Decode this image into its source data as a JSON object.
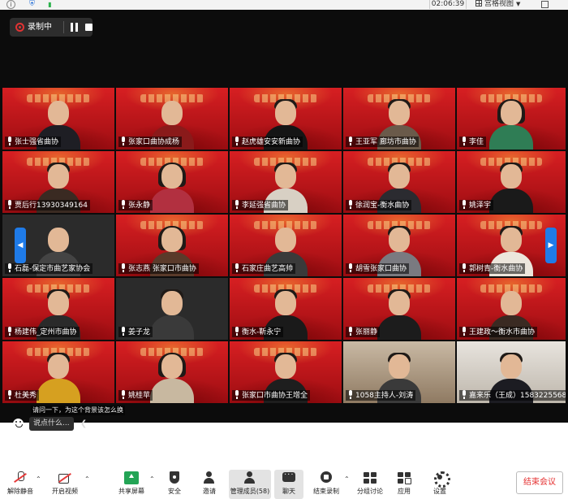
{
  "status_bar": {
    "clock": "02:06:39",
    "view_mode": "宫格视图"
  },
  "recording": {
    "label": "录制中"
  },
  "participants": [
    {
      "name": "张士强省曲协",
      "bg": "red",
      "style": "bald",
      "shirt": "#1e1e24"
    },
    {
      "name": "张家口曲协成杨",
      "bg": "red",
      "style": "bald",
      "shirt": "#8a1a1a"
    },
    {
      "name": "赵虎雄安安新曲协",
      "bg": "red",
      "style": "short",
      "shirt": "#151515"
    },
    {
      "name": "王亚军  廊坊市曲协",
      "bg": "red",
      "style": "short",
      "shirt": "#6a5a4a"
    },
    {
      "name": "李佳",
      "bg": "red",
      "style": "long",
      "shirt": "#2f7d55"
    },
    {
      "name": "贾后行13930349164",
      "bg": "red",
      "style": "short",
      "shirt": "#3a2a22"
    },
    {
      "name": "张永静",
      "bg": "red",
      "style": "long",
      "shirt": "#b23040"
    },
    {
      "name": "李延强省曲协",
      "bg": "red",
      "style": "short",
      "shirt": "#d8d0c4"
    },
    {
      "name": "徐润宝-衡水曲协",
      "bg": "red",
      "style": "short",
      "shirt": "#2b2b30"
    },
    {
      "name": "姚泽宇",
      "bg": "red",
      "style": "short",
      "shirt": "#1a1a1a"
    },
    {
      "name": "石磊-保定市曲艺家协会",
      "bg": "dark",
      "style": "bald",
      "shirt": "#444444"
    },
    {
      "name": "张志燕 张家口市曲协",
      "bg": "red",
      "style": "long",
      "shirt": "#5a3a2a"
    },
    {
      "name": "石家庄曲艺高帅",
      "bg": "red",
      "style": "bald",
      "shirt": "#3a3a3a"
    },
    {
      "name": "胡雪张家口曲协",
      "bg": "red",
      "style": "short",
      "shirt": "#7a7a80"
    },
    {
      "name": "郭树青-衡水曲协",
      "bg": "red",
      "style": "short",
      "shirt": "#ece6dc"
    },
    {
      "name": "杨建伟_定州市曲协",
      "bg": "red",
      "style": "short",
      "shirt": "#2a2a2a"
    },
    {
      "name": "姜子龙",
      "bg": "dark",
      "style": "short",
      "shirt": "#3a3a3a"
    },
    {
      "name": "衡水-靳永宁",
      "bg": "red",
      "style": "short",
      "shirt": "#1a1a1a"
    },
    {
      "name": "张丽静",
      "bg": "red",
      "style": "short",
      "shirt": "#1c1c1c"
    },
    {
      "name": "王建政～衡水市曲协",
      "bg": "red",
      "style": "bald",
      "shirt": "#3a2a22"
    },
    {
      "name": "杜美秀",
      "bg": "red",
      "style": "short",
      "shirt": "#d6a020"
    },
    {
      "name": "姚桂苹",
      "bg": "red",
      "style": "long",
      "shirt": "#c8b8a0"
    },
    {
      "name": "张家口市曲协王增全",
      "bg": "red",
      "style": "short",
      "shirt": "#1e1e1e"
    },
    {
      "name": "1058主持人-刘涛",
      "bg": "room",
      "style": "short",
      "shirt": "#3a3a3a"
    },
    {
      "name": "嘉来乐（王成）15832255686",
      "bg": "room2",
      "style": "short",
      "shirt": "#1c1c22"
    }
  ],
  "chat": {
    "recent_message": "请问一下，为这个背景该怎么换",
    "input_placeholder": "说点什么..."
  },
  "toolbar": {
    "unmute": "解除静音",
    "start_video": "开启视频",
    "share_screen": "共享屏幕",
    "security": "安全",
    "invite": "邀请",
    "manage_members": "管理成员(58)",
    "chat": "聊天",
    "end_recording": "结束录制",
    "breakout_rooms": "分组讨论",
    "apps": "应用",
    "settings": "设置",
    "end_meeting": "结束会议"
  }
}
